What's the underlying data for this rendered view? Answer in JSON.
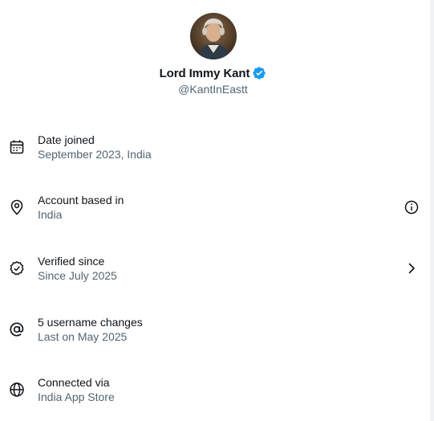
{
  "profile": {
    "display_name": "Lord Immy Kant",
    "handle": "@KantInEastt",
    "verified": true,
    "verified_color": "#1d9bf0"
  },
  "rows": [
    {
      "icon": "calendar-icon",
      "title": "Date joined",
      "subtitle": "September 2023, India"
    },
    {
      "icon": "location-pin-icon",
      "title": "Account based in",
      "subtitle": "India",
      "action_icon": "info-icon"
    },
    {
      "icon": "verified-check-icon",
      "title": "Verified since",
      "subtitle": "Since July 2025",
      "action_icon": "chevron-right-icon"
    },
    {
      "icon": "at-sign-icon",
      "title": "5 username changes",
      "subtitle": "Last on May 2025"
    },
    {
      "icon": "globe-icon",
      "title": "Connected via",
      "subtitle": "India App Store"
    }
  ],
  "colors": {
    "text_primary": "#0f1419",
    "text_secondary": "#536471"
  }
}
